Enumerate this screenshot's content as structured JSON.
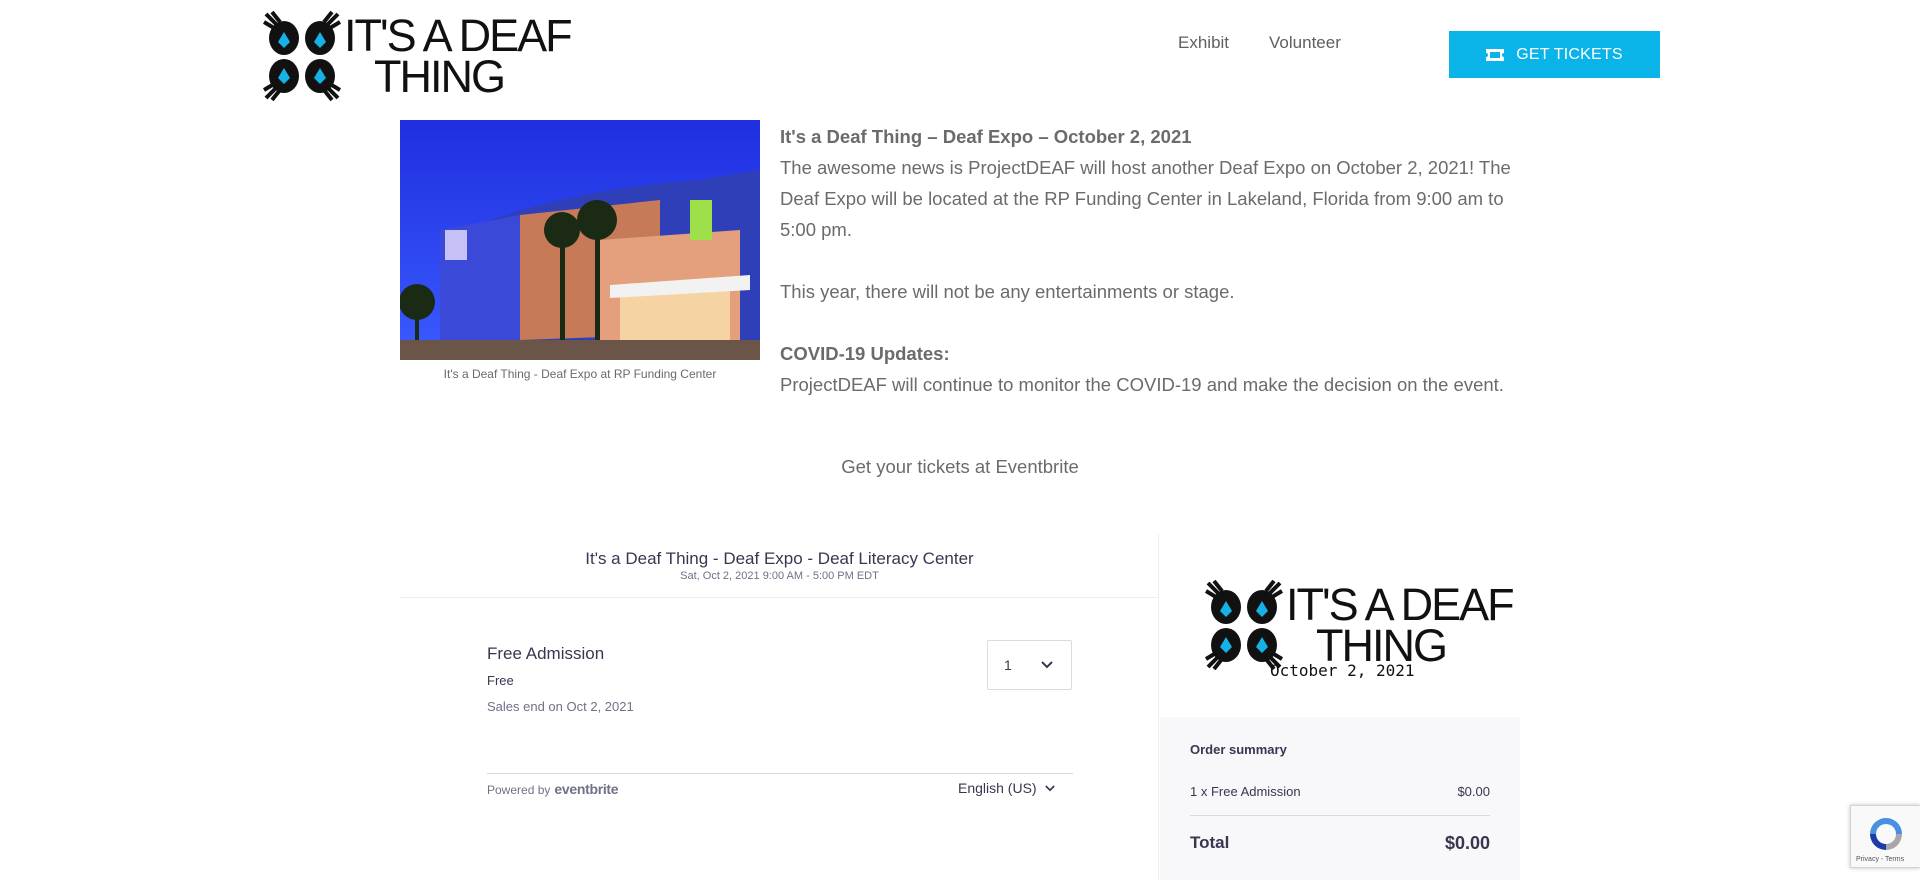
{
  "brand": {
    "line1": "IT'S A DEAF",
    "line2": "THING"
  },
  "nav": [
    {
      "label": "Exhibit"
    },
    {
      "label": "Volunteer"
    }
  ],
  "cta": {
    "label": "GET TICKETS"
  },
  "intro": {
    "caption": "It's a Deaf Thing - Deaf Expo at RP Funding Center",
    "heading": "It's a Deaf Thing – Deaf Expo – October 2, 2021",
    "body1": "The awesome news is ProjectDEAF will host another Deaf Expo on October 2, 2021! The Deaf Expo will be located at the RP Funding Center in Lakeland, Florida from 9:00 am to 5:00 pm.",
    "body2": "This year, there will not be any entertainments or stage.",
    "covid_heading": "COVID-19 Updates:",
    "covid_body": "ProjectDEAF will continue to monitor the COVID-19 and make the decision on the event."
  },
  "tickets_link": "Get your tickets at Eventbrite",
  "eventbrite": {
    "event_title": "It's a Deaf Thing - Deaf Expo - Deaf Literacy Center",
    "event_date": "Sat, Oct 2, 2021 9:00 AM - 5:00 PM EDT",
    "ticket": {
      "name": "Free Admission",
      "price": "Free",
      "sales_end": "Sales end on Oct 2, 2021",
      "quantity": "1"
    },
    "powered_by": "Powered by",
    "powered_brand": "eventbrite",
    "language": "English (US)",
    "logo_date": "October 2, 2021",
    "summary": {
      "title": "Order summary",
      "line_label": "1 x Free Admission",
      "line_amount": "$0.00",
      "total_label": "Total",
      "total_amount": "$0.00"
    }
  },
  "recaptcha": {
    "terms": "Privacy - Terms"
  },
  "colors": {
    "accent": "#0ab3e8",
    "text": "#6b6b6b",
    "eventbrite_text": "#39364f"
  }
}
